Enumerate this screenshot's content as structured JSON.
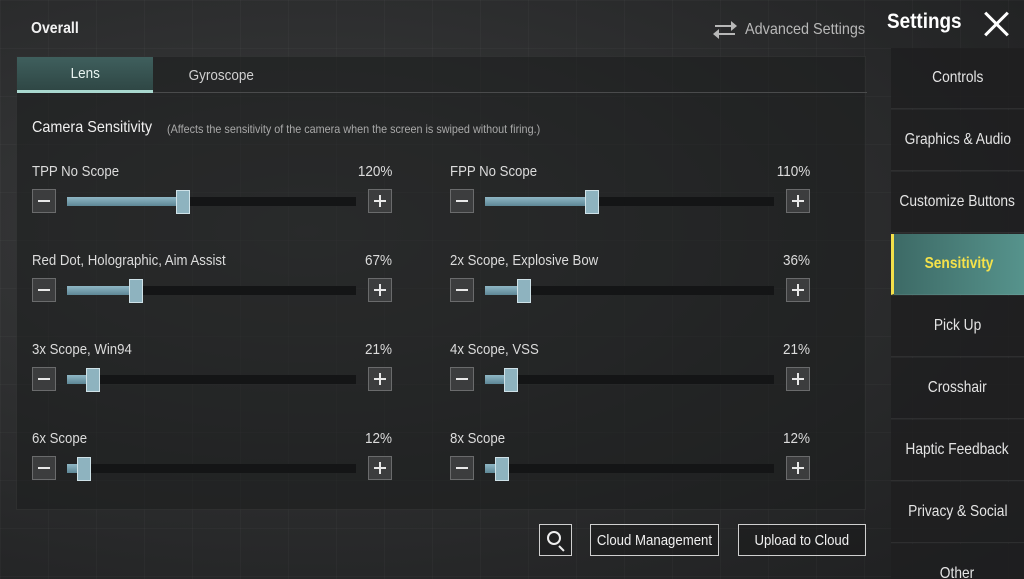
{
  "header": {
    "overall": "Overall",
    "advanced_settings": "Advanced Settings",
    "settings_title": "Settings"
  },
  "tabs": [
    {
      "label": "Lens",
      "active": true
    },
    {
      "label": "Gyroscope",
      "active": false
    }
  ],
  "section": {
    "title": "Camera Sensitivity",
    "description": "(Affects the sensitivity of the camera when the screen is swiped without firing.)"
  },
  "sliders": [
    {
      "label": "TPP No Scope",
      "value": "120%",
      "fill": 0.4
    },
    {
      "label": "FPP No Scope",
      "value": "110%",
      "fill": 0.37
    },
    {
      "label": "Red Dot, Holographic, Aim Assist",
      "value": "67%",
      "fill": 0.24
    },
    {
      "label": "2x Scope, Explosive Bow",
      "value": "36%",
      "fill": 0.135
    },
    {
      "label": "3x Scope, Win94",
      "value": "21%",
      "fill": 0.09
    },
    {
      "label": "4x Scope, VSS",
      "value": "21%",
      "fill": 0.09
    },
    {
      "label": "6x Scope",
      "value": "12%",
      "fill": 0.06
    },
    {
      "label": "8x Scope",
      "value": "12%",
      "fill": 0.06
    }
  ],
  "bottom_buttons": {
    "cloud_management": "Cloud Management",
    "upload_to_cloud": "Upload to Cloud"
  },
  "sidebar": {
    "items": [
      {
        "label": "Controls",
        "active": false
      },
      {
        "label": "Graphics & Audio",
        "active": false
      },
      {
        "label": "Customize Buttons",
        "active": false
      },
      {
        "label": "Sensitivity",
        "active": true
      },
      {
        "label": "Pick Up",
        "active": false
      },
      {
        "label": "Crosshair",
        "active": false
      },
      {
        "label": "Haptic Feedback",
        "active": false
      },
      {
        "label": "Privacy & Social",
        "active": false
      },
      {
        "label": "Other",
        "active": false
      }
    ]
  },
  "colors": {
    "accent_active_tab": "#3f5f5d",
    "sidebar_active": "#56938c",
    "sidebar_active_text": "#f5e24a",
    "slider_fill": "#8fb7c5"
  }
}
